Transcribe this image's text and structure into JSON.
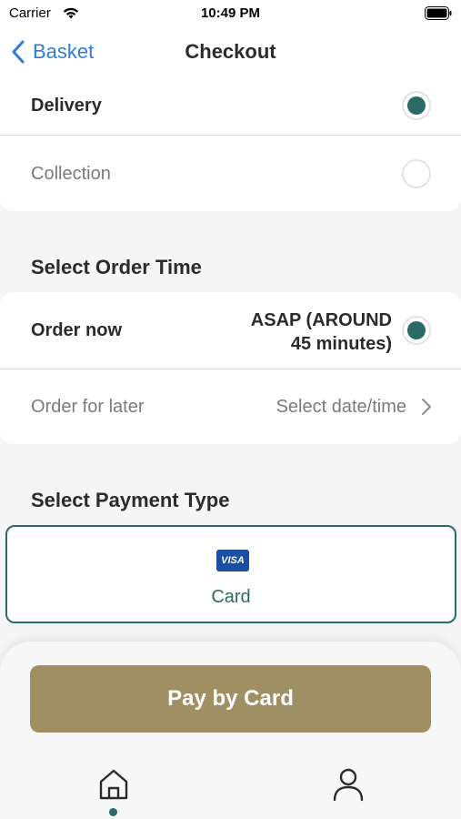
{
  "status_bar": {
    "carrier": "Carrier",
    "time": "10:49 PM"
  },
  "nav": {
    "back_label": "Basket",
    "title": "Checkout"
  },
  "delivery_options": [
    {
      "label": "Delivery",
      "selected": true
    },
    {
      "label": "Collection",
      "selected": false
    }
  ],
  "order_time": {
    "heading": "Select Order Time",
    "now_label": "Order now",
    "now_value_line1": "ASAP (AROUND",
    "now_value_line2": "45 minutes)",
    "later_label": "Order for later",
    "later_value": "Select date/time"
  },
  "payment": {
    "heading": "Select Payment Type",
    "card_brand": "VISA",
    "option_label": "Card"
  },
  "footer": {
    "pay_button": "Pay by Card"
  },
  "colors": {
    "accent": "#2a6a67",
    "pay_button": "#a08f62",
    "link": "#2f7ed8"
  }
}
